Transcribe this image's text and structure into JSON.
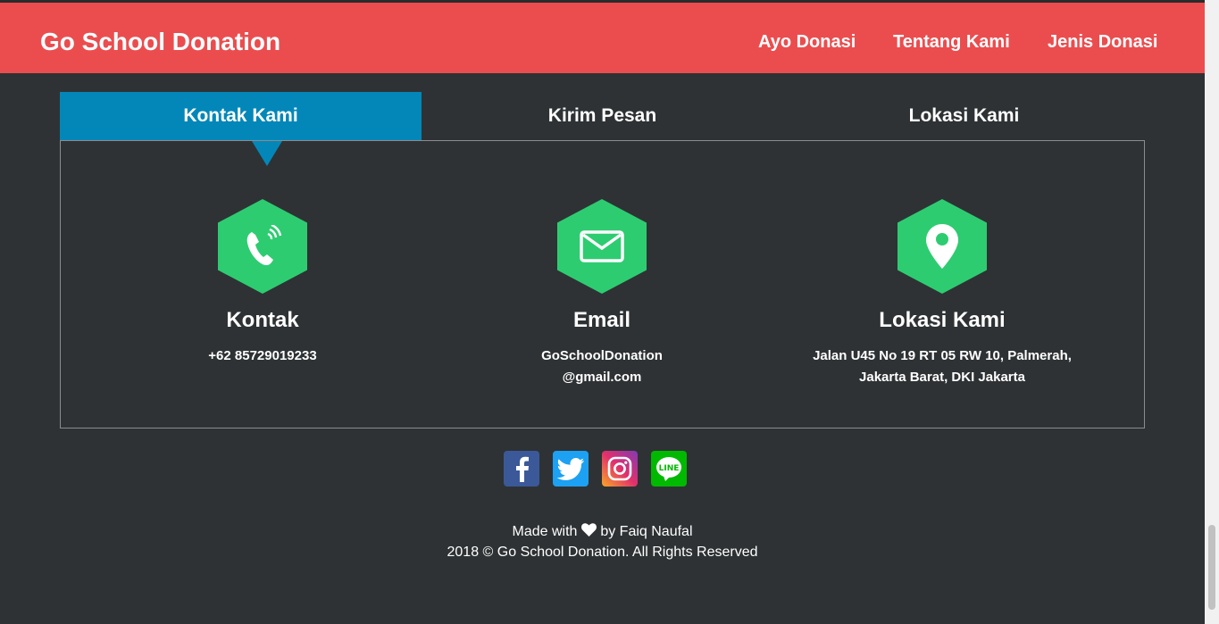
{
  "navbar": {
    "brand": "Go School Donation",
    "links": [
      "Ayo Donasi",
      "Tentang Kami",
      "Jenis Donasi"
    ],
    "color": "#eb4d4f"
  },
  "tabs": [
    {
      "label": "Kontak Kami",
      "active": true
    },
    {
      "label": "Kirim Pesan",
      "active": false
    },
    {
      "label": "Lokasi Kami",
      "active": false
    }
  ],
  "contact": [
    {
      "icon": "phone-icon",
      "title": "Kontak",
      "lines": [
        "+62 85729019233"
      ]
    },
    {
      "icon": "envelope-icon",
      "title": "Email",
      "lines": [
        "GoSchoolDonation",
        "@gmail.com"
      ]
    },
    {
      "icon": "map-pin-icon",
      "title": "Lokasi Kami",
      "lines": [
        "Jalan U45 No 19 RT 05 RW 10, Palmerah,",
        "Jakarta Barat, DKI Jakarta"
      ]
    }
  ],
  "social": [
    "facebook-icon",
    "twitter-icon",
    "instagram-icon",
    "line-icon"
  ],
  "footer": {
    "made_with_prefix": "Made with",
    "made_with_suffix": "by Faiq Naufal",
    "copyright": "2018 © Go School Donation. All Rights Reserved"
  },
  "colors": {
    "background": "#2e3234",
    "tab_active": "#0387b9",
    "icon_green": "#2ecc71"
  }
}
